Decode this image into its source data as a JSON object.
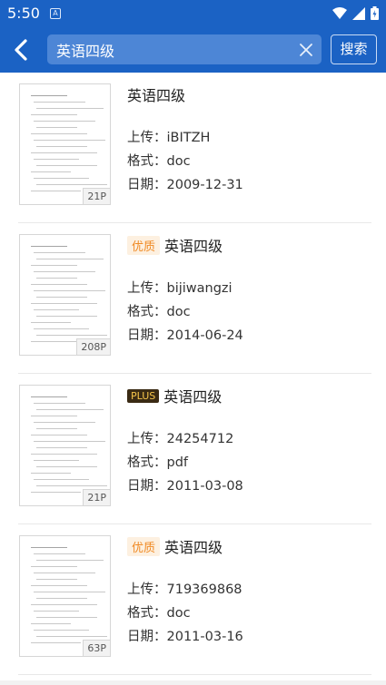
{
  "status_bar": {
    "time": "5:50",
    "app_badge": "A"
  },
  "toolbar": {
    "query": "英语四级",
    "search_label": "搜索"
  },
  "labels": {
    "uploader": "上传：",
    "format": "格式：",
    "date": "日期："
  },
  "results": [
    {
      "title": "英语四级",
      "badge": "",
      "uploader": "iBITZH",
      "format": "doc",
      "date": "2009-12-31",
      "pages": "21P"
    },
    {
      "title": "英语四级",
      "badge": "优质",
      "uploader": "bijiwangzi",
      "format": "doc",
      "date": "2014-06-24",
      "pages": "208P"
    },
    {
      "title": "英语四级",
      "badge": "PLUS",
      "uploader": "24254712",
      "format": "pdf",
      "date": "2011-03-08",
      "pages": "21P"
    },
    {
      "title": "英语四级",
      "badge": "优质",
      "uploader": "719369868",
      "format": "doc",
      "date": "2011-03-16",
      "pages": "63P"
    }
  ]
}
